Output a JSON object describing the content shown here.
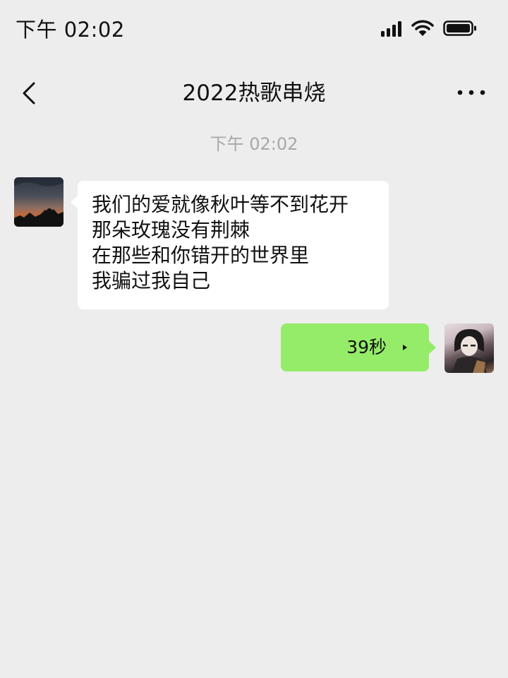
{
  "status_bar": {
    "time": "下午 02:02",
    "icons": [
      "signal-icon",
      "wifi-icon",
      "battery-icon"
    ]
  },
  "nav": {
    "title": "2022热歌串烧",
    "icons": [
      "back-arrow-icon",
      "more-icon"
    ]
  },
  "chat": {
    "timestamp": "下午 02:02",
    "messages": [
      {
        "side": "left",
        "type": "text",
        "lines": [
          "我们的爱就像秋叶等不到花开",
          "那朵玫瑰没有荆棘",
          "在那些和你错开的世界里",
          "我骗过我自己"
        ]
      },
      {
        "side": "right",
        "type": "voice",
        "duration": "39秒"
      }
    ]
  },
  "colors": {
    "background": "#ededed",
    "incoming_bubble": "#ffffff",
    "outgoing_bubble": "#95ec69",
    "timestamp_text": "#a8a8a8"
  }
}
